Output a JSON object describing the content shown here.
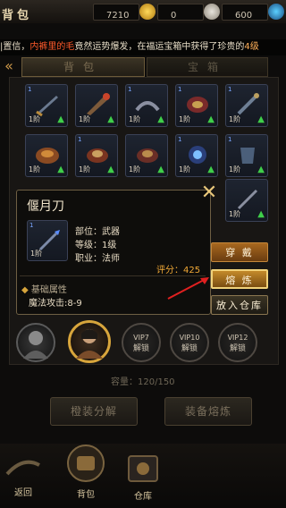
{
  "header": {
    "title": "背包",
    "resource_1_value": "7210",
    "resource_2_value": "0",
    "resource_3_value": "600"
  },
  "marquee": {
    "prefix": "|置信，",
    "highlight_1": "内裤里的毛",
    "middle": "竟然运势爆发，在福运宝箱中获得了珍贵的",
    "highlight_2": "4级"
  },
  "tabs": [
    {
      "label": "背包",
      "active": true
    },
    {
      "label": "宝箱",
      "active": false
    }
  ],
  "slot_level_label": "1阶",
  "tooltip": {
    "name": "偃月刀",
    "slot_level": "1阶",
    "part": "部位：武器",
    "level": "等级：1级",
    "profession": "职业：法师",
    "score": "评分：425",
    "base_attr_title": "基础属性",
    "base_attr_value": "魔法攻击:8-9"
  },
  "actions": {
    "equip": "穿 戴",
    "smelt": "熔 炼",
    "to_storage": "放入仓库"
  },
  "characters": [
    {
      "vip": "VIP7",
      "status": "解锁"
    },
    {
      "vip": "VIP10",
      "status": "解锁"
    },
    {
      "vip": "VIP12",
      "status": "解锁"
    }
  ],
  "capacity": "容量：120/150",
  "buttons": {
    "decompose": "橙装分解",
    "smelt_equipment": "装备熔炼"
  },
  "bottom_nav": [
    {
      "label": "返回"
    },
    {
      "label": "背包"
    },
    {
      "label": "仓库"
    }
  ],
  "colors": {
    "accent_gold": "#d7a53c",
    "highlight_red": "#ff5a2b",
    "upgrade_green": "#3fcf4a",
    "score_orange": "#f0a836"
  }
}
